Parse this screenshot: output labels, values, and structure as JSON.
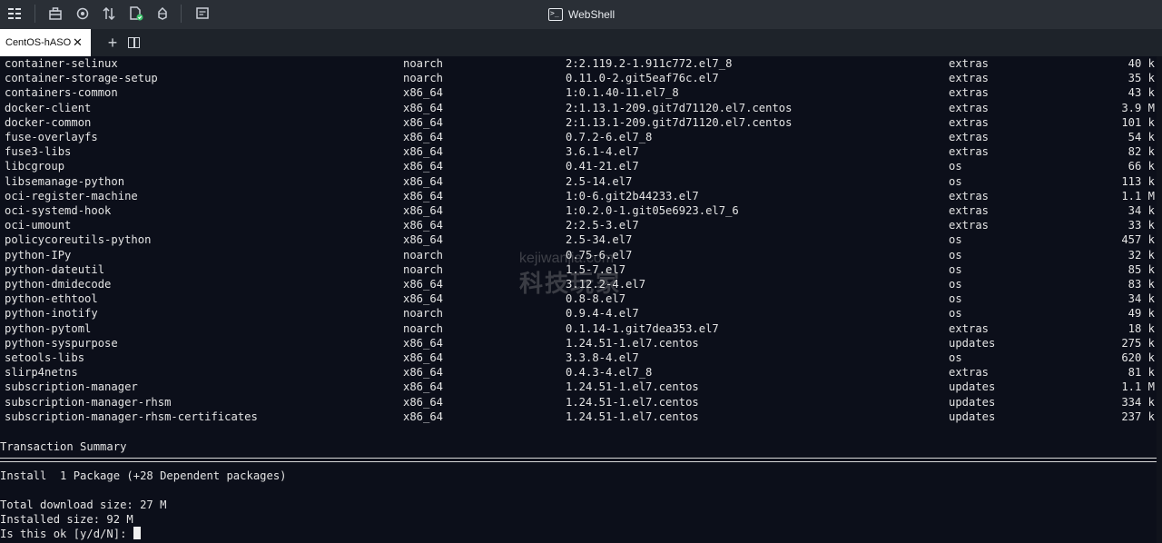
{
  "toolbar": {
    "icons": [
      "menu-icon",
      "toolbox-icon",
      "target-icon",
      "transfer-icon",
      "file-check-icon",
      "rocket-icon",
      "history-icon"
    ]
  },
  "window": {
    "title": "WebShell"
  },
  "tabs": [
    {
      "label": "CentOS-hASO",
      "close": "✕"
    }
  ],
  "tab_actions": {
    "add": "+"
  },
  "packages": [
    {
      "name": "container-selinux",
      "arch": "noarch",
      "version": "2:2.119.2-1.911c772.el7_8",
      "repo": "extras",
      "size": "40 k"
    },
    {
      "name": "container-storage-setup",
      "arch": "noarch",
      "version": "0.11.0-2.git5eaf76c.el7",
      "repo": "extras",
      "size": "35 k"
    },
    {
      "name": "containers-common",
      "arch": "x86_64",
      "version": "1:0.1.40-11.el7_8",
      "repo": "extras",
      "size": "43 k"
    },
    {
      "name": "docker-client",
      "arch": "x86_64",
      "version": "2:1.13.1-209.git7d71120.el7.centos",
      "repo": "extras",
      "size": "3.9 M"
    },
    {
      "name": "docker-common",
      "arch": "x86_64",
      "version": "2:1.13.1-209.git7d71120.el7.centos",
      "repo": "extras",
      "size": "101 k"
    },
    {
      "name": "fuse-overlayfs",
      "arch": "x86_64",
      "version": "0.7.2-6.el7_8",
      "repo": "extras",
      "size": "54 k"
    },
    {
      "name": "fuse3-libs",
      "arch": "x86_64",
      "version": "3.6.1-4.el7",
      "repo": "extras",
      "size": "82 k"
    },
    {
      "name": "libcgroup",
      "arch": "x86_64",
      "version": "0.41-21.el7",
      "repo": "os",
      "size": "66 k"
    },
    {
      "name": "libsemanage-python",
      "arch": "x86_64",
      "version": "2.5-14.el7",
      "repo": "os",
      "size": "113 k"
    },
    {
      "name": "oci-register-machine",
      "arch": "x86_64",
      "version": "1:0-6.git2b44233.el7",
      "repo": "extras",
      "size": "1.1 M"
    },
    {
      "name": "oci-systemd-hook",
      "arch": "x86_64",
      "version": "1:0.2.0-1.git05e6923.el7_6",
      "repo": "extras",
      "size": "34 k"
    },
    {
      "name": "oci-umount",
      "arch": "x86_64",
      "version": "2:2.5-3.el7",
      "repo": "extras",
      "size": "33 k"
    },
    {
      "name": "policycoreutils-python",
      "arch": "x86_64",
      "version": "2.5-34.el7",
      "repo": "os",
      "size": "457 k"
    },
    {
      "name": "python-IPy",
      "arch": "noarch",
      "version": "0.75-6.el7",
      "repo": "os",
      "size": "32 k"
    },
    {
      "name": "python-dateutil",
      "arch": "noarch",
      "version": "1.5-7.el7",
      "repo": "os",
      "size": "85 k"
    },
    {
      "name": "python-dmidecode",
      "arch": "x86_64",
      "version": "3.12.2-4.el7",
      "repo": "os",
      "size": "83 k"
    },
    {
      "name": "python-ethtool",
      "arch": "x86_64",
      "version": "0.8-8.el7",
      "repo": "os",
      "size": "34 k"
    },
    {
      "name": "python-inotify",
      "arch": "noarch",
      "version": "0.9.4-4.el7",
      "repo": "os",
      "size": "49 k"
    },
    {
      "name": "python-pytoml",
      "arch": "noarch",
      "version": "0.1.14-1.git7dea353.el7",
      "repo": "extras",
      "size": "18 k"
    },
    {
      "name": "python-syspurpose",
      "arch": "x86_64",
      "version": "1.24.51-1.el7.centos",
      "repo": "updates",
      "size": "275 k"
    },
    {
      "name": "setools-libs",
      "arch": "x86_64",
      "version": "3.3.8-4.el7",
      "repo": "os",
      "size": "620 k"
    },
    {
      "name": "slirp4netns",
      "arch": "x86_64",
      "version": "0.4.3-4.el7_8",
      "repo": "extras",
      "size": "81 k"
    },
    {
      "name": "subscription-manager",
      "arch": "x86_64",
      "version": "1.24.51-1.el7.centos",
      "repo": "updates",
      "size": "1.1 M"
    },
    {
      "name": "subscription-manager-rhsm",
      "arch": "x86_64",
      "version": "1.24.51-1.el7.centos",
      "repo": "updates",
      "size": "334 k"
    },
    {
      "name": "subscription-manager-rhsm-certificates",
      "arch": "x86_64",
      "version": "1.24.51-1.el7.centos",
      "repo": "updates",
      "size": "237 k"
    }
  ],
  "summary": {
    "heading": "Transaction Summary",
    "install_line": "Install  1 Package (+28 Dependent packages)",
    "download_size": "Total download size: 27 M",
    "installed_size": "Installed size: 92 M",
    "prompt": "Is this ok [y/d/N]:"
  },
  "watermark": {
    "line1": "kejiwanjia.com",
    "line2": "科技玩家"
  }
}
